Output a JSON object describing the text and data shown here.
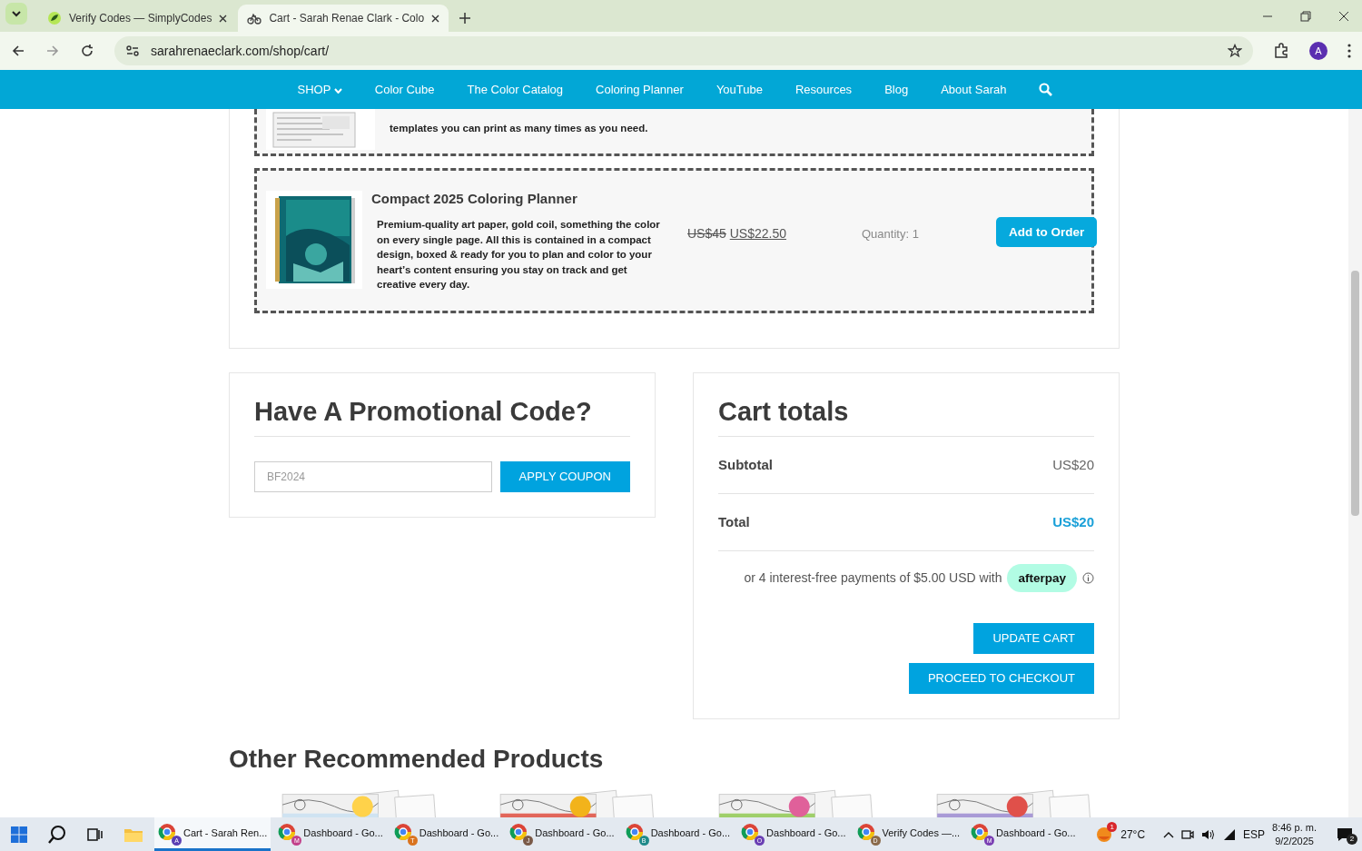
{
  "browser": {
    "tabs": [
      {
        "title": "Verify Codes — SimplyCodes",
        "selected": false
      },
      {
        "title": "Cart - Sarah Renae Clark - Colo",
        "selected": true
      }
    ],
    "address": "sarahrenaeclark.com/shop/cart/",
    "profile": "A"
  },
  "nav": {
    "items": [
      {
        "label": "SHOP",
        "kind": "dropdown"
      },
      {
        "label": "Color Cube",
        "kind": "link"
      },
      {
        "label": "The Color Catalog",
        "kind": "link"
      },
      {
        "label": "Coloring Planner",
        "kind": "link"
      },
      {
        "label": "YouTube",
        "kind": "link"
      },
      {
        "label": "Resources",
        "kind": "link"
      },
      {
        "label": "Blog",
        "kind": "link"
      },
      {
        "label": "About Sarah",
        "kind": "link"
      },
      {
        "kind": "search"
      }
    ]
  },
  "cart_items": [
    {
      "kind": "partial",
      "description": "templates you can print as many times as you need."
    },
    {
      "kind": "full",
      "title": "Compact 2025 Coloring Planner",
      "description": "Premium-quality art paper, gold coil, something the color on every single page. All this is contained in a compact design, boxed & ready for you to plan and color to your heart’s content ensuring you stay on track and get creative every day.",
      "old_price": "US$45",
      "price": "US$22.50",
      "quantity": "Quantity: 1",
      "button": "Add to Order"
    }
  ],
  "promo": {
    "heading": "Have A Promotional Code?",
    "placeholder": "BF2024",
    "button": "APPLY COUPON"
  },
  "totals": {
    "heading": "Cart totals",
    "rows": [
      {
        "label": "Subtotal",
        "value": "US$20",
        "kind": "subtotal"
      },
      {
        "label": "Total",
        "value": "US$20",
        "kind": "total"
      }
    ],
    "installments": "or 4 interest-free payments of $5.00 USD with",
    "afterpay": "afterpay",
    "buttons": [
      "UPDATE CART",
      "PROCEED TO CHECKOUT"
    ]
  },
  "recommended": {
    "heading": "Other Recommended Products"
  },
  "taskbar": {
    "apps": [
      {
        "label": "Cart - Sarah Ren...",
        "badge": "A",
        "color": "#5b3fb3",
        "selected": true
      },
      {
        "label": "Dashboard - Go...",
        "badge": "M",
        "color": "#c2408a",
        "selected": false
      },
      {
        "label": "Dashboard - Go...",
        "badge": "T",
        "color": "#d9731f",
        "selected": false
      },
      {
        "label": "Dashboard - Go...",
        "badge": "J",
        "color": "#7a5a48",
        "selected": false
      },
      {
        "label": "Dashboard - Go...",
        "badge": "B",
        "color": "#1f8a8a",
        "selected": false
      },
      {
        "label": "Dashboard - Go...",
        "badge": "O",
        "color": "#6a3fb3",
        "selected": false
      },
      {
        "label": "Verify Codes —...",
        "badge": "D",
        "color": "#8a6a4a",
        "selected": false
      },
      {
        "label": "Dashboard - Go...",
        "badge": "M",
        "color": "#7a3fb3",
        "selected": false
      }
    ],
    "weather_alert": "1",
    "temperature": "27°C",
    "language": "ESP",
    "time": "8:46 p. m.",
    "date": "9/2/2025",
    "notifications": "2"
  }
}
